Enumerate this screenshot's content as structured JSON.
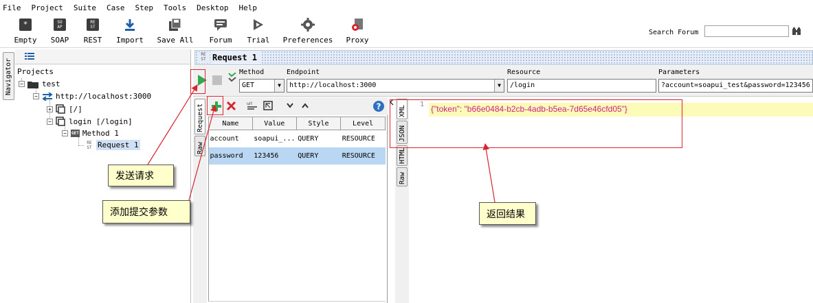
{
  "menu": [
    "File",
    "Project",
    "Suite",
    "Case",
    "Step",
    "Tools",
    "Desktop",
    "Help"
  ],
  "toolbar": {
    "buttons": [
      {
        "label": "Empty",
        "icon": "empty-icon",
        "badge": "*"
      },
      {
        "label": "SOAP",
        "icon": "soap-icon",
        "badge": "SO AP"
      },
      {
        "label": "REST",
        "icon": "rest-icon",
        "badge": "RE ST"
      },
      {
        "label": "Import",
        "icon": "import-icon"
      },
      {
        "label": "Save All",
        "icon": "save-all-icon"
      },
      {
        "label": "Forum",
        "icon": "forum-icon"
      },
      {
        "label": "Trial",
        "icon": "trial-icon"
      },
      {
        "label": "Preferences",
        "icon": "preferences-icon"
      },
      {
        "label": "Proxy",
        "icon": "proxy-icon"
      }
    ],
    "search_label": "Search Forum",
    "search_value": ""
  },
  "navigator": {
    "label": "Navigator"
  },
  "tree": {
    "root": "Projects",
    "project": "test",
    "service": "http://localhost:3000",
    "resource_root": "[/]",
    "resource": "login [/login]",
    "method_badge": "GET",
    "method": "Method 1",
    "request_badge": "RE ST",
    "request": "Request 1"
  },
  "request": {
    "header_badge": "RE ST",
    "title": "Request 1",
    "method_label": "Method",
    "method_value": "GET",
    "endpoint_label": "Endpoint",
    "endpoint_value": "http://localhost:3000",
    "resource_label": "Resource",
    "resource_value": "/login",
    "params_label": "Parameters",
    "params_value": "?account=soapui_test&password=123456",
    "left_tabs": [
      "Request",
      "Raw"
    ],
    "table": {
      "headers": [
        "Name",
        "Value",
        "Style",
        "Level"
      ],
      "rows": [
        [
          "account",
          "soapui_...",
          "QUERY",
          "RESOURCE"
        ],
        [
          "password",
          "123456",
          "QUERY",
          "RESOURCE"
        ]
      ]
    }
  },
  "response": {
    "tabs": [
      "XML",
      "JSON",
      "HTML",
      "Raw"
    ],
    "line_number": "1",
    "body": "{\"token\": \"b66e0484-b2cb-4adb-b5ea-7d65e46cfd05\"}"
  },
  "annotations": {
    "send": "发送请求",
    "add_params": "添加提交参数",
    "result": "返回结果"
  },
  "colors": {
    "accent_red": "#d9232e",
    "callout_bg": "#ffffcc",
    "json_text": "#d0208a",
    "selected_row": "#b9d6f2",
    "run_green": "#2fa84f"
  }
}
